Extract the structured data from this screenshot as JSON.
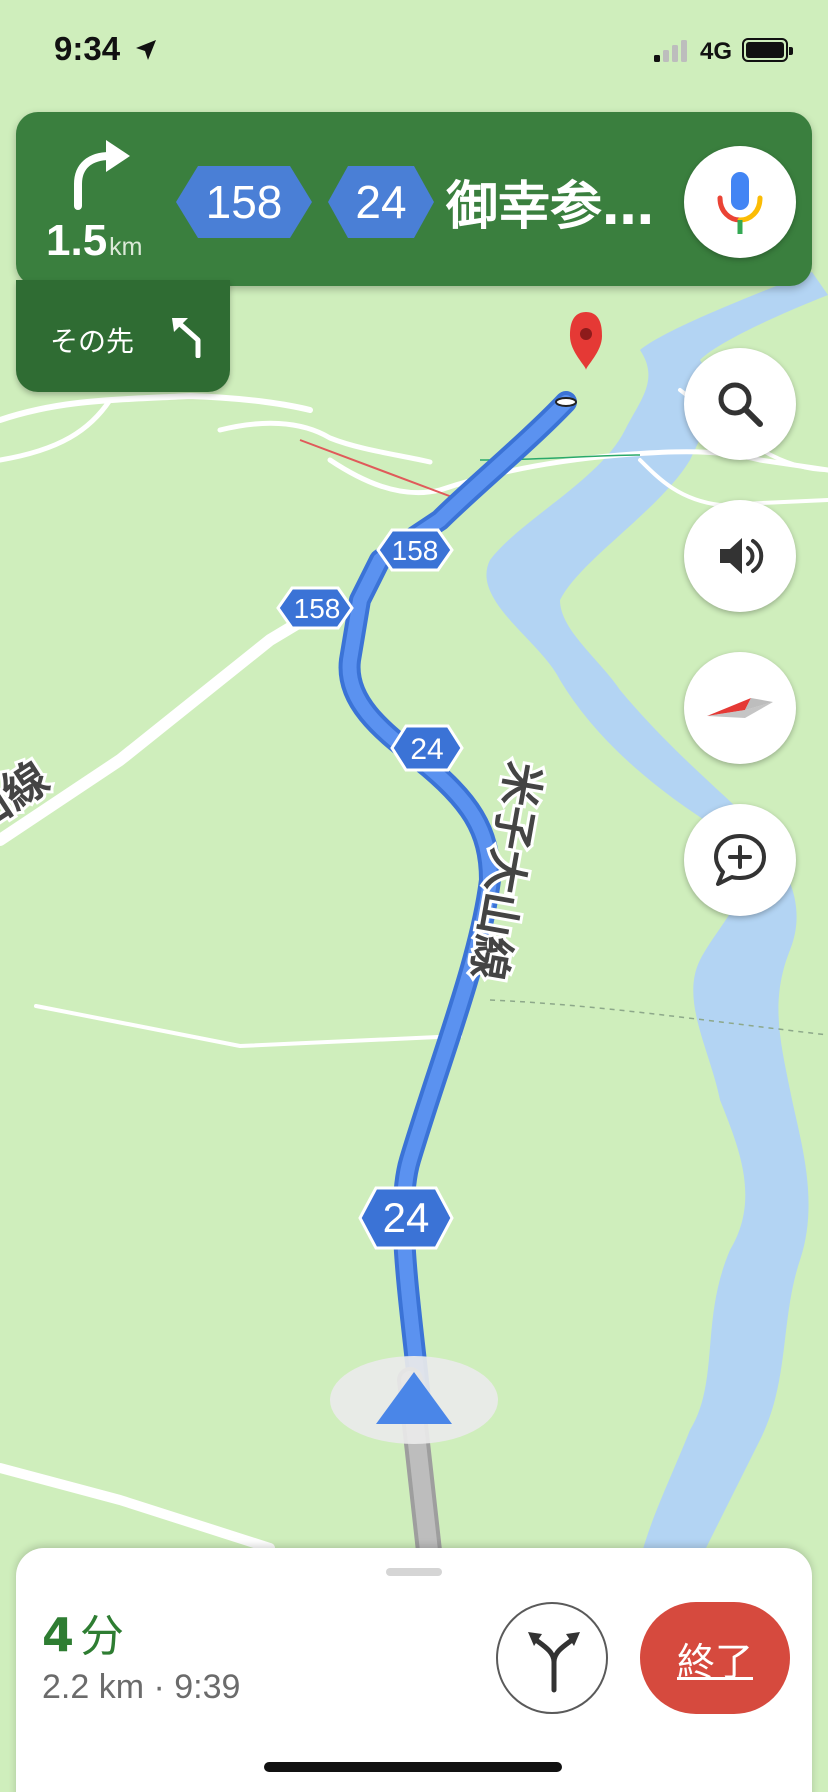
{
  "status_bar": {
    "time": "9:34",
    "network": "4G",
    "location_icon": "location-arrow-icon",
    "signal_icon": "cellular-signal-icon",
    "battery_icon": "battery-icon"
  },
  "navigation": {
    "distance": "1.5",
    "distance_unit": "km",
    "turn_icon": "turn-right-arrow-icon",
    "route_shields": [
      "158",
      "24"
    ],
    "street": "御幸参…",
    "mic_icon": "google-mic-icon",
    "then_label": "その先",
    "then_icon": "turn-left-arrow-icon"
  },
  "map": {
    "road_labels": [
      "米子大山線",
      "大山線",
      "158",
      "158",
      "24",
      "24"
    ],
    "destination_icon": "destination-pin-icon",
    "position_icon": "navigation-arrow-icon"
  },
  "controls": {
    "search_icon": "search-icon",
    "sound_icon": "volume-icon",
    "compass_icon": "compass-icon",
    "report_icon": "add-report-icon"
  },
  "trip": {
    "eta_minutes": "4",
    "eta_unit": "分",
    "details": "2.2 km · 9:39",
    "alt_routes_icon": "alternate-routes-icon",
    "end_button": "終了"
  },
  "colors": {
    "nav_green": "#3a7f3e",
    "nav_green_dark": "#2f6c33",
    "map_green": "#cfeebc",
    "water_blue": "#b3d4f3",
    "route_blue": "#4a86e8",
    "end_red": "#d64a3e",
    "eta_green": "#2e7d32"
  }
}
